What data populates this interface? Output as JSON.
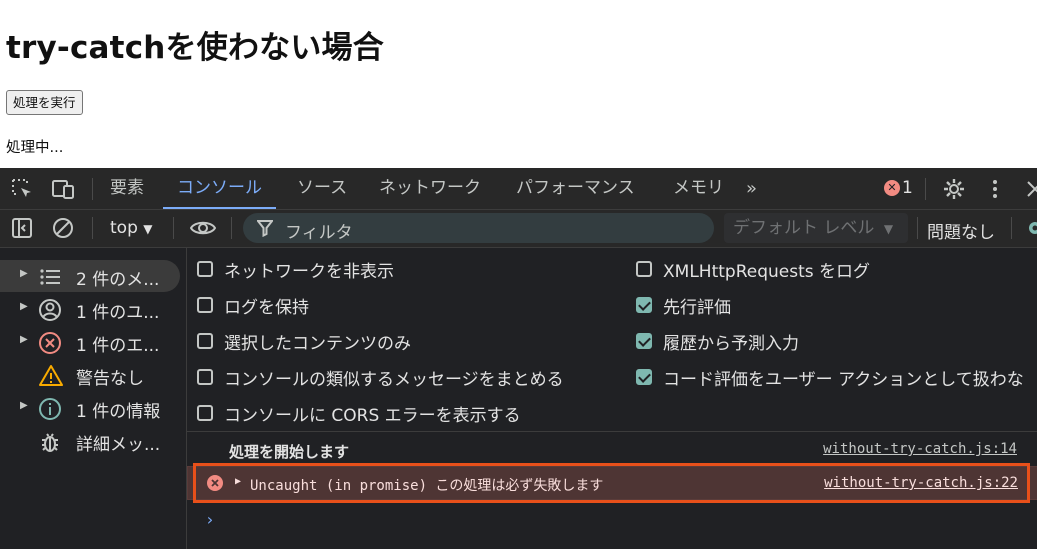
{
  "page": {
    "title": "try-catchを使わない場合",
    "run_button": "処理を実行",
    "status": "処理中..."
  },
  "devtools": {
    "tabs": [
      "要素",
      "コンソール",
      "ソース",
      "ネットワーク",
      "パフォーマンス",
      "メモリ"
    ],
    "active_tab": "コンソール",
    "error_count": "1",
    "toolbar": {
      "context": "top",
      "filter_placeholder": "フィルタ",
      "levels": "デフォルト レベル",
      "issues": "問題なし"
    },
    "sidebar": [
      {
        "label": "2 件のメ...",
        "icon": "list-icon",
        "expandable": true
      },
      {
        "label": "1 件のユ...",
        "icon": "user-icon",
        "expandable": true
      },
      {
        "label": "1 件のエ...",
        "icon": "error-icon",
        "expandable": true
      },
      {
        "label": "警告なし",
        "icon": "warning-icon",
        "expandable": false
      },
      {
        "label": "1 件の情報",
        "icon": "info-icon",
        "expandable": true
      },
      {
        "label": "詳細メッ...",
        "icon": "bug-icon",
        "expandable": false
      }
    ],
    "settings_left": [
      {
        "label": "ネットワークを非表示",
        "checked": false
      },
      {
        "label": "ログを保持",
        "checked": false
      },
      {
        "label": "選択したコンテンツのみ",
        "checked": false
      },
      {
        "label": "コンソールの類似するメッセージをまとめる",
        "checked": false
      },
      {
        "label": "コンソールに CORS エラーを表示する",
        "checked": false
      }
    ],
    "settings_right": [
      {
        "label": "XMLHttpRequests をログ",
        "checked": false
      },
      {
        "label": "先行評価",
        "checked": true
      },
      {
        "label": "履歴から予測入力",
        "checked": true
      },
      {
        "label": "コード評価をユーザー アクションとして扱わな",
        "checked": true
      }
    ],
    "messages": [
      {
        "type": "log",
        "text": "処理を開始します",
        "source": "without-try-catch.js:14"
      },
      {
        "type": "error",
        "text": "Uncaught (in promise) この処理は必ず失敗します",
        "source": "without-try-catch.js:22"
      }
    ],
    "prompt": "›",
    "colors": {
      "accent": "#7cacf8",
      "error_bg": "#4e3534",
      "highlight": "#e8501a",
      "checkbox": "#7fb8b0"
    }
  }
}
